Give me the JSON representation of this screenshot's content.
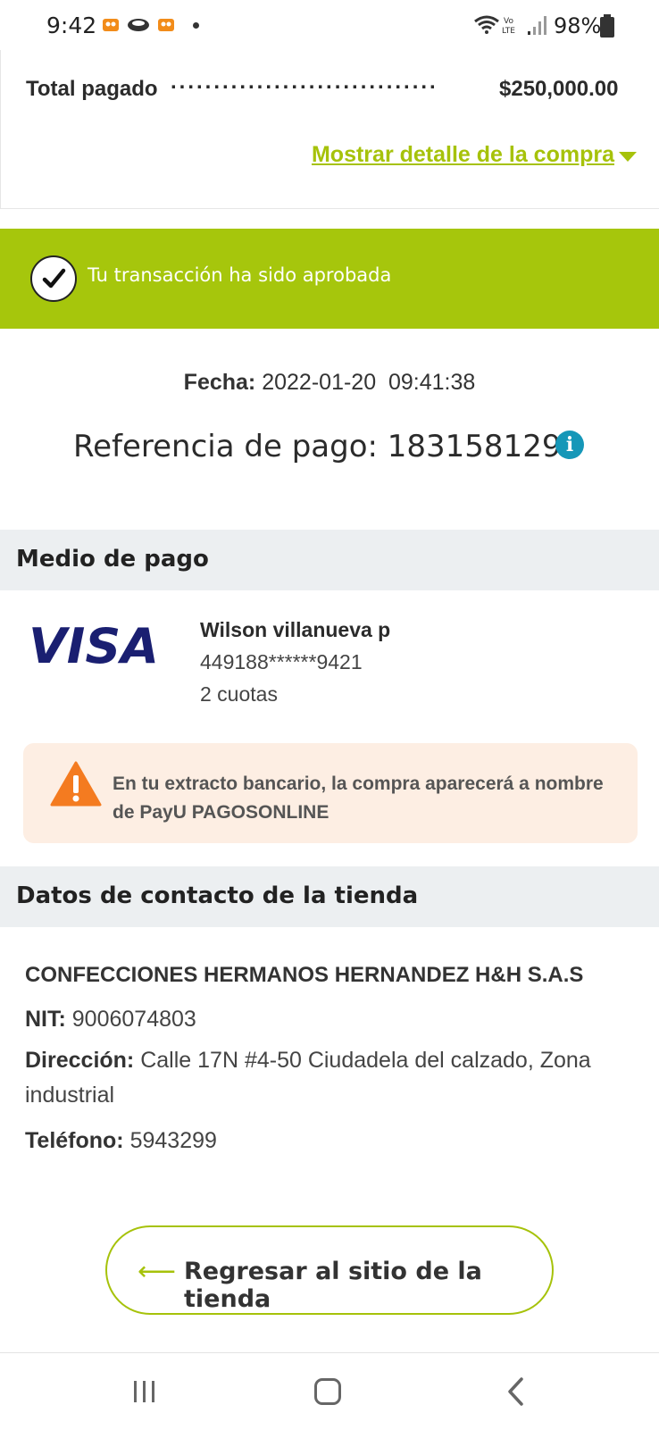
{
  "status_bar": {
    "time": "9:42",
    "battery": "98%"
  },
  "summary": {
    "total_label": "Total pagado",
    "total_dots": "...............................",
    "total_amount": "$250,000.00",
    "show_detail_label": "Mostrar detalle de la compra"
  },
  "banner": {
    "text": "Tu transacción ha sido aprobada",
    "color": "#a6c60c"
  },
  "transaction": {
    "date_label": "Fecha:",
    "date_value": "2022-01-20  09:41:38",
    "reference_label": "Referencia de pago:",
    "reference_value": "1831581291",
    "info_icon": "i"
  },
  "payment": {
    "header": "Medio de pago",
    "card_brand": "VISA",
    "holder": "Wilson villanueva p",
    "card_number": "449188******9421",
    "installments": "2 cuotas",
    "warning": "En tu extracto bancario, la compra aparecerá a nombre de PayU PAGOSONLINE"
  },
  "contact": {
    "header": "Datos de contacto de la tienda",
    "store_name": "CONFECCIONES HERMANOS HERNANDEZ H&H S.A.S",
    "nit_label": "NIT:",
    "nit_value": "9006074803",
    "address_label": "Dirección:",
    "address_value": "Calle 17N #4-50 Ciudadela del calzado, Zona industrial",
    "phone_label": "Teléfono:",
    "phone_value": "5943299"
  },
  "actions": {
    "return_arrow": "⟵",
    "return_label": "Regresar al sitio de la tienda"
  },
  "colors": {
    "accent_green": "#a6c20a",
    "info_blue": "#1597b8",
    "warning_orange": "#f47b20"
  }
}
